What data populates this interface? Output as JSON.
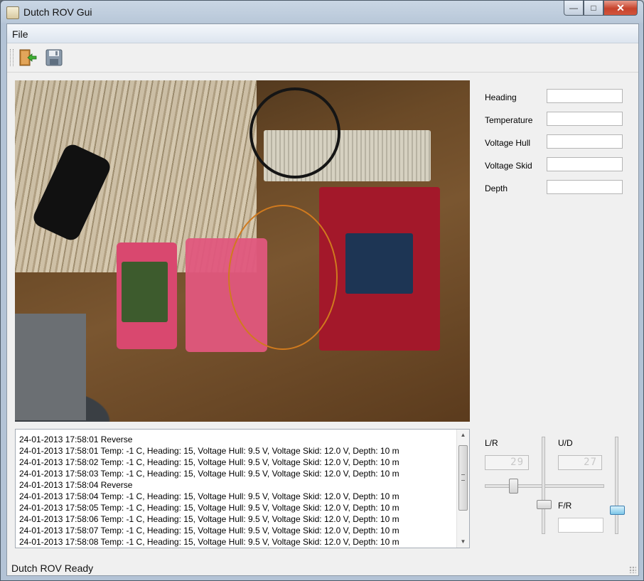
{
  "window": {
    "title": "Dutch ROV Gui"
  },
  "window_controls": {
    "minimize": "—",
    "maximize": "□",
    "close": "✕"
  },
  "menu": {
    "file": "File"
  },
  "toolbar": {
    "buttons": [
      {
        "icon": "exit-door-icon"
      },
      {
        "icon": "floppy-disk-save-icon"
      }
    ]
  },
  "fields": {
    "heading": {
      "label": "Heading",
      "value": ""
    },
    "temperature": {
      "label": "Temperature",
      "value": ""
    },
    "voltage_hull": {
      "label": "Voltage Hull",
      "value": ""
    },
    "voltage_skid": {
      "label": "Voltage Skid",
      "value": ""
    },
    "depth": {
      "label": "Depth",
      "value": ""
    }
  },
  "log": {
    "lines": [
      "24-01-2013 17:58:01 Reverse",
      "24-01-2013 17:58:01 Temp: -1 C, Heading: 15, Voltage Hull: 9.5 V, Voltage Skid: 12.0 V, Depth: 10 m",
      "24-01-2013 17:58:02 Temp: -1 C, Heading: 15, Voltage Hull: 9.5 V, Voltage Skid: 12.0 V, Depth: 10 m",
      "24-01-2013 17:58:03 Temp: -1 C, Heading: 15, Voltage Hull: 9.5 V, Voltage Skid: 12.0 V, Depth: 10 m",
      "24-01-2013 17:58:04 Reverse",
      "24-01-2013 17:58:04 Temp: -1 C, Heading: 15, Voltage Hull: 9.5 V, Voltage Skid: 12.0 V, Depth: 10 m",
      "24-01-2013 17:58:05 Temp: -1 C, Heading: 15, Voltage Hull: 9.5 V, Voltage Skid: 12.0 V, Depth: 10 m",
      "24-01-2013 17:58:06 Temp: -1 C, Heading: 15, Voltage Hull: 9.5 V, Voltage Skid: 12.0 V, Depth: 10 m",
      "24-01-2013 17:58:07 Temp: -1 C, Heading: 15, Voltage Hull: 9.5 V, Voltage Skid: 12.0 V, Depth: 10 m",
      "24-01-2013 17:58:08 Temp: -1 C, Heading: 15, Voltage Hull: 9.5 V, Voltage Skid: 12.0 V, Depth: 10 m"
    ]
  },
  "controls": {
    "lr": {
      "label": "L/R",
      "value": "29"
    },
    "ud": {
      "label": "U/D",
      "value": "27"
    },
    "fr": {
      "label": "F/R",
      "value": ""
    }
  },
  "status": {
    "text": "Dutch ROV Ready"
  },
  "colors": {
    "accent_slider": "#7cc6e8",
    "close_button": "#c6432c"
  }
}
